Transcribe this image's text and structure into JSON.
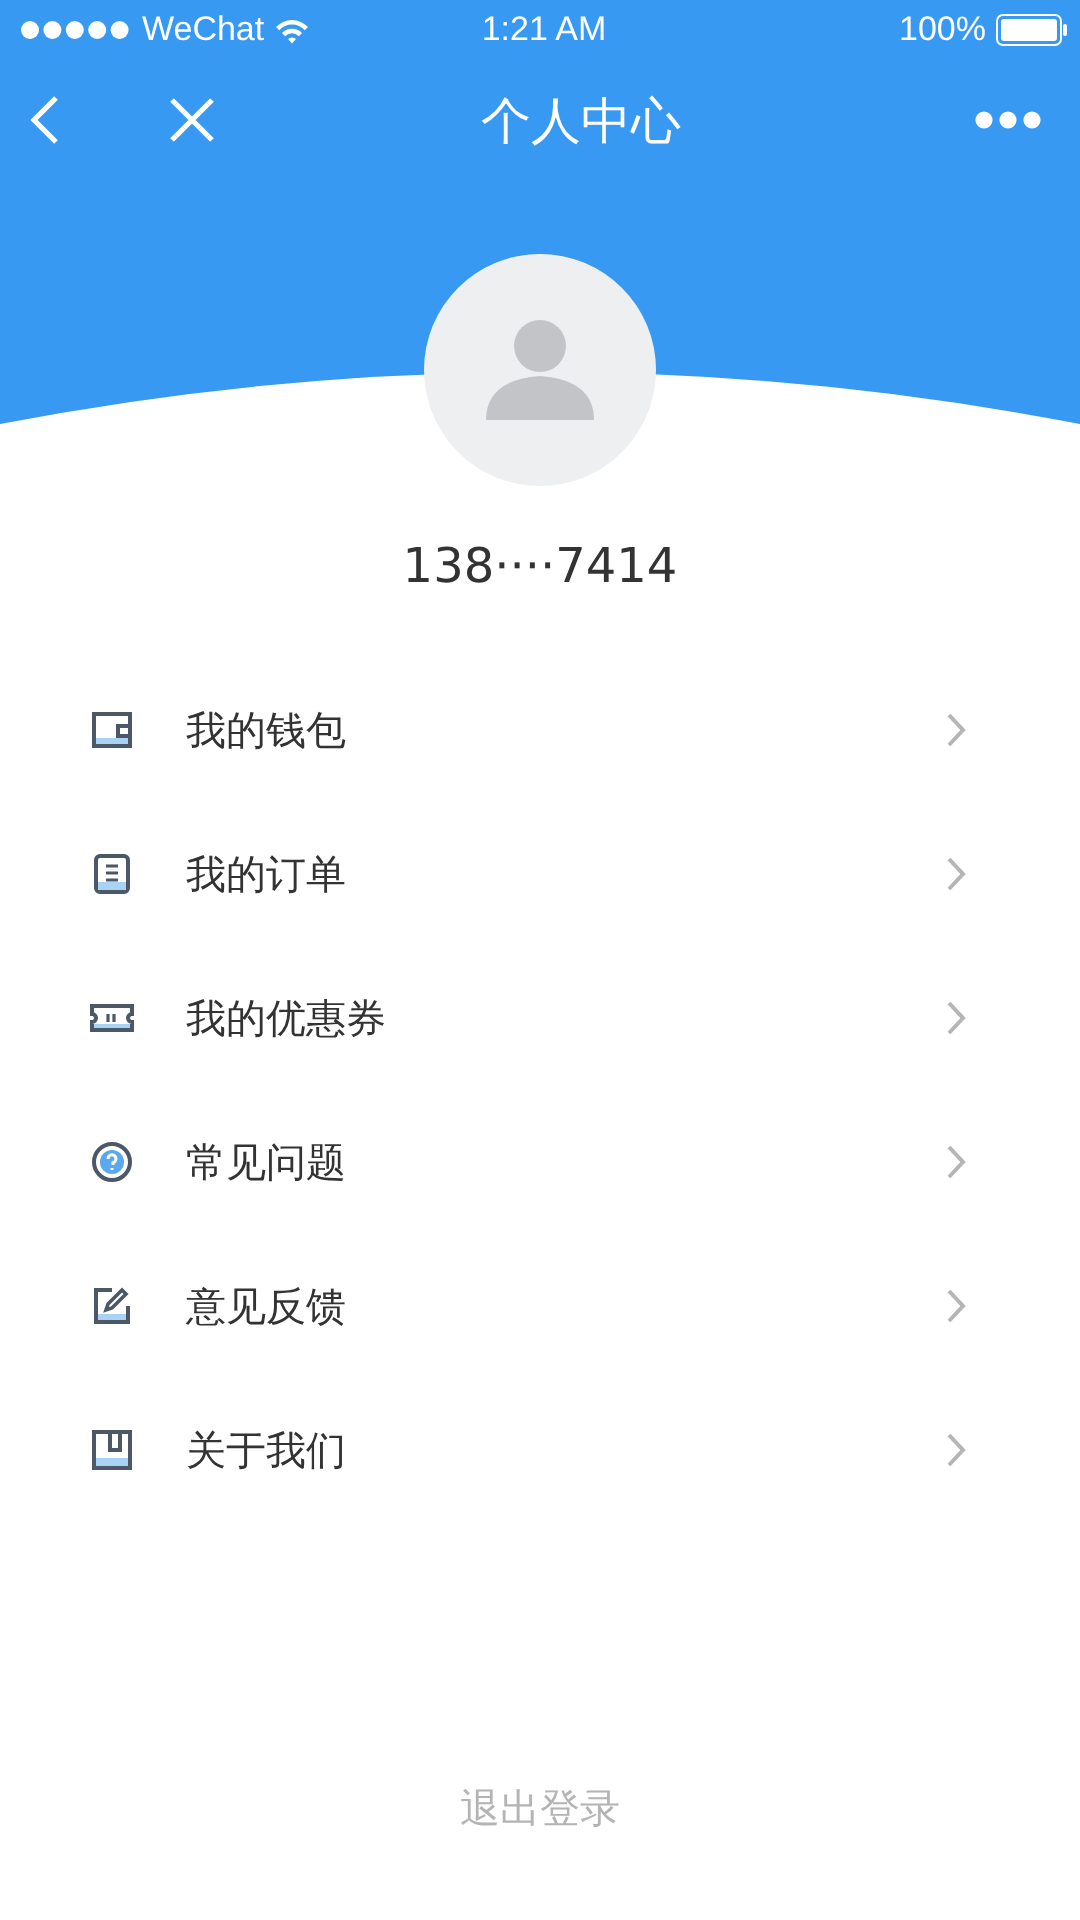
{
  "status_bar": {
    "carrier": "WeChat",
    "time": "1:21 AM",
    "battery": "100%"
  },
  "nav": {
    "title": "个人中心"
  },
  "profile": {
    "phone": "138····7414"
  },
  "menu": [
    {
      "kind": "wallet",
      "label": "我的钱包"
    },
    {
      "kind": "order",
      "label": "我的订单"
    },
    {
      "kind": "coupon",
      "label": "我的优惠券"
    },
    {
      "kind": "faq",
      "label": "常见问题"
    },
    {
      "kind": "feedback",
      "label": "意见反馈"
    },
    {
      "kind": "about",
      "label": "关于我们"
    }
  ],
  "logout": "退出登录"
}
